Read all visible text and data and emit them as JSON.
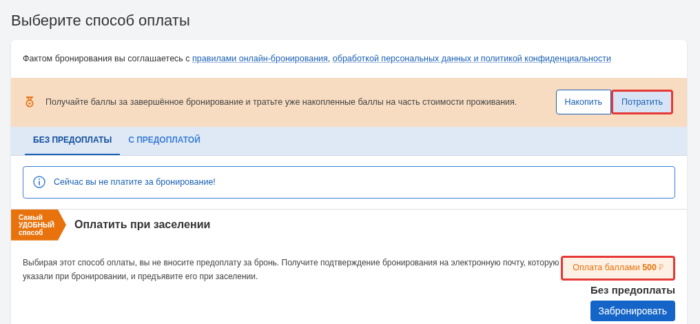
{
  "page_title": "Выберите способ оплаты",
  "agreement": {
    "text": "Фактом бронирования вы соглашаетесь с",
    "links": [
      "правилами онлайн-бронирования",
      "обработкой персональных данных и политикой конфиденциальности"
    ],
    "separator": ","
  },
  "points_banner": {
    "text": "Получайте баллы за завершённое бронирование и тратьте уже накопленные баллы на часть стоимости проживания.",
    "options": [
      {
        "label": "Накопить",
        "selected": false,
        "highlighted": false
      },
      {
        "label": "Потратить",
        "selected": true,
        "highlighted": true
      }
    ]
  },
  "tabs": [
    {
      "label": "БЕЗ ПРЕДОПЛАТЫ",
      "selected": true
    },
    {
      "label": "С ПРЕДОПЛАТОЙ",
      "selected": false
    }
  ],
  "notice": "Сейчас вы не платите за бронирование!",
  "option": {
    "badge_lines": [
      "Самый",
      "УДОБНЫЙ",
      "способ"
    ],
    "title": "Оплатить при заселении",
    "description": "Выбирая этот способ оплаты, вы не вносите предоплату за бронь. Получите подтверждение бронирования на электронную почту, которую указали при бронировании, и предъявите его при заселении.",
    "points_payment": {
      "text": "Оплата баллами **500**",
      "currency": "₽",
      "highlighted": true
    },
    "price_label": "Без предоплаты",
    "book_button": "Забронировать"
  }
}
